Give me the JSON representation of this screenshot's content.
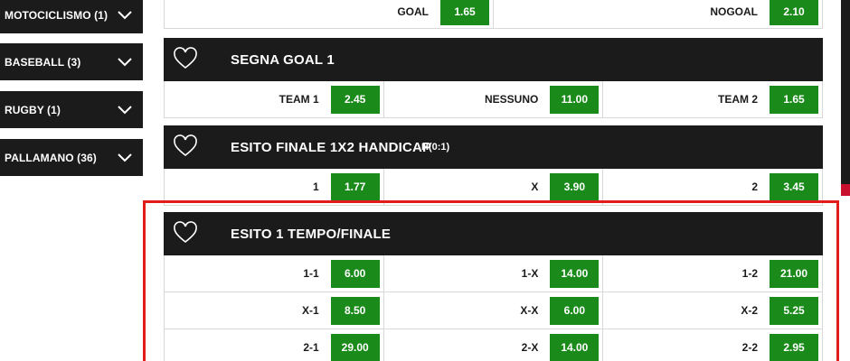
{
  "sidebar": {
    "items": [
      {
        "label": "MOTOCICLISMO (1)"
      },
      {
        "label": "BASEBALL (3)"
      },
      {
        "label": "RUGBY (1)"
      },
      {
        "label": "PALLAMANO (36)"
      }
    ]
  },
  "markets": [
    {
      "title": "",
      "rows": [
        [
          {
            "label": "GOAL",
            "odd": "1.65"
          },
          {
            "label": "NOGOAL",
            "odd": "2.10"
          }
        ]
      ]
    },
    {
      "title": "SEGNA GOAL 1",
      "rows": [
        [
          {
            "label": "TEAM 1",
            "odd": "2.45"
          },
          {
            "label": "NESSUNO",
            "odd": "11.00"
          },
          {
            "label": "TEAM 2",
            "odd": "1.65"
          }
        ]
      ]
    },
    {
      "title": "ESITO FINALE 1X2 HANDICAP",
      "subtitle": "H(0:1)",
      "rows": [
        [
          {
            "label": "1",
            "odd": "1.77"
          },
          {
            "label": "X",
            "odd": "3.90"
          },
          {
            "label": "2",
            "odd": "3.45"
          }
        ]
      ]
    },
    {
      "title": "ESITO 1 TEMPO/FINALE",
      "rows": [
        [
          {
            "label": "1-1",
            "odd": "6.00"
          },
          {
            "label": "1-X",
            "odd": "14.00"
          },
          {
            "label": "1-2",
            "odd": "21.00"
          }
        ],
        [
          {
            "label": "X-1",
            "odd": "8.50"
          },
          {
            "label": "X-X",
            "odd": "6.00"
          },
          {
            "label": "X-2",
            "odd": "5.25"
          }
        ],
        [
          {
            "label": "2-1",
            "odd": "29.00"
          },
          {
            "label": "2-X",
            "odd": "14.00"
          },
          {
            "label": "2-2",
            "odd": "2.95"
          }
        ]
      ]
    }
  ],
  "colors": {
    "dark": "#1b1b1b",
    "odd_green": "#1a8a1a",
    "highlight_red": "#e21b1b",
    "accent_red": "#c8102e"
  }
}
